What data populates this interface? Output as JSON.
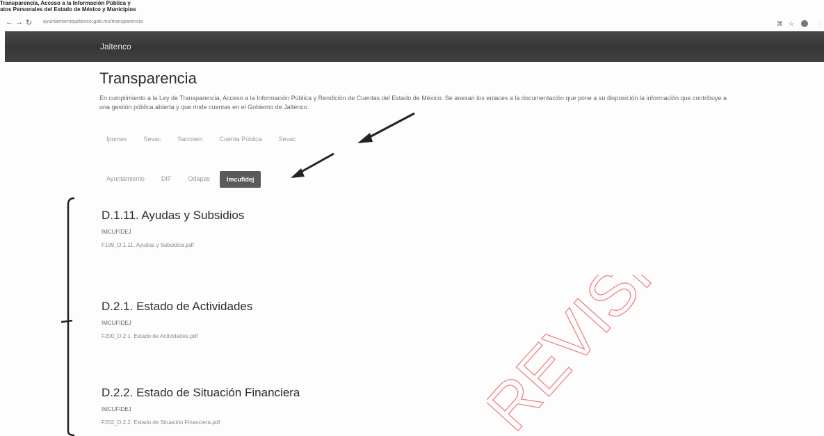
{
  "document_header": {
    "line1": "Transparencia, Acceso a la Información Pública y",
    "line2": "atos Personales del Estado de México y Municipios"
  },
  "browser": {
    "back_glyph": "←",
    "forward_glyph": "→",
    "reload_glyph": "↻",
    "url": "ayuntamientojaltenco.gob.mx/transparencia",
    "icons": [
      "translate-icon",
      "star-icon",
      "profile-icon",
      "menu-icon"
    ]
  },
  "navbar": {
    "brand": "Jaltenco"
  },
  "page": {
    "title": "Transparencia",
    "intro": "En cumplimiento a la Ley de Transparencia, Acceso a la Información Pública y Rendición de Cuentas del Estado de México. Se anexan los enlaces a la documentación que pone a su disposición la información que contribuye a una gestión pública abierta y que rinde cuentas en el Gobierno de Jaltenco.",
    "categories": [
      "Ipomex",
      "Sevac",
      "Sarcoem",
      "Cuenta Pública",
      "Sevac"
    ],
    "categories_active": 4,
    "entities": [
      "Ayuntamiento",
      "DIF",
      "Odapas",
      "Imcufidej"
    ],
    "entities_active": 3
  },
  "sections": [
    {
      "title": "D.1.11. Ayudas y Subsidios",
      "org": "IMCUFIDEJ",
      "file": "F199_D.1.11. Ayudas y Subsidios.pdf"
    },
    {
      "title": "D.2.1. Estado de Actividades",
      "org": "IMCUFIDEJ",
      "file": "F200_D.2.1. Estado de Actividades.pdf"
    },
    {
      "title": "D.2.2. Estado de Situación Financiera",
      "org": "IMCUFIDEJ",
      "file": "F202_D.2.2. Estado de Situación Financiera.pdf"
    }
  ],
  "watermark": {
    "text": "REVISIÓN",
    "color": "#e85a5a"
  },
  "colors": {
    "navbar": "#3d3d3d",
    "active_pill": "#5a5a5a",
    "annotation": "#222222"
  }
}
